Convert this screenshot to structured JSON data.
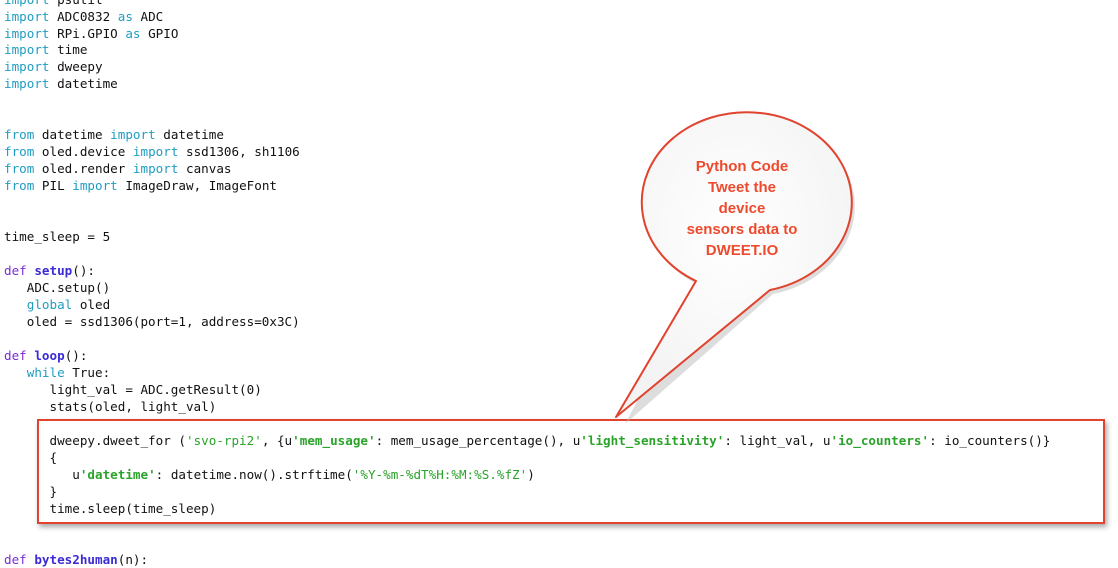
{
  "code": {
    "imports": [
      {
        "kw": "import",
        "rest": " psutil"
      },
      {
        "kw": "import",
        "rest": " ADC0832 ",
        "kw2": "as",
        "rest2": " ADC"
      },
      {
        "kw": "import",
        "rest": " RPi.GPIO ",
        "kw2": "as",
        "rest2": " GPIO"
      },
      {
        "kw": "import",
        "rest": " time"
      },
      {
        "kw": "import",
        "rest": " dweepy"
      },
      {
        "kw": "import",
        "rest": " datetime"
      }
    ],
    "from_imports": [
      {
        "a": "from",
        "b": " datetime ",
        "c": "import",
        "d": " datetime"
      },
      {
        "a": "from",
        "b": " oled.device ",
        "c": "import",
        "d": " ssd1306, sh1106"
      },
      {
        "a": "from",
        "b": " oled.render ",
        "c": "import",
        "d": " canvas"
      },
      {
        "a": "from",
        "b": " PIL ",
        "c": "import",
        "d": " ImageDraw, ImageFont"
      }
    ],
    "time_sleep_line": "time_sleep = 5",
    "setup": {
      "def": "def",
      "name": "setup",
      "sig": "():",
      "l1": "   ADC.setup()",
      "global_kw": "global",
      "global_rest": " oled",
      "l3": "   oled = ssd1306(port=1, address=0x3C)"
    },
    "loop": {
      "def": "def",
      "name": "loop",
      "sig": "():",
      "while_kw": "while",
      "while_rest": " True:",
      "l2": "      light_val = ADC.getResult(0)",
      "l3": "      stats(oled, light_val)"
    },
    "dweet": {
      "p1": "      dweepy.dweet_for (",
      "s1": "'svo-rpi2'",
      "p2": ", {u",
      "s2": "'mem_usage'",
      "p3": ": mem_usage_percentage(), u",
      "s3": "'light_sensitivity'",
      "p4": ": light_val, u",
      "s4": "'io_counters'",
      "p5": ": io_counters()}",
      "brace_open": "      {",
      "dt_p1": "         u",
      "dt_s1": "'datetime'",
      "dt_p2": ": datetime.now().strftime(",
      "dt_s2": "'%Y-%m-%dT%H:%M:%S.%fZ'",
      "dt_p3": ")",
      "brace_close": "      }",
      "sleep": "      time.sleep(time_sleep)"
    },
    "bytes2human": {
      "def": "def",
      "name": "bytes2human",
      "sig": "(n):"
    }
  },
  "callout": {
    "line1": "Python Code",
    "line2": "Tweet the device",
    "line3": "sensors data to",
    "line4": "DWEET.IO"
  },
  "colors": {
    "keyword": "#1f9dc1",
    "string": "#2aa32a",
    "function": "#3a2bd6",
    "callout_border": "#e0432e",
    "callout_text": "#ee4a2d"
  }
}
